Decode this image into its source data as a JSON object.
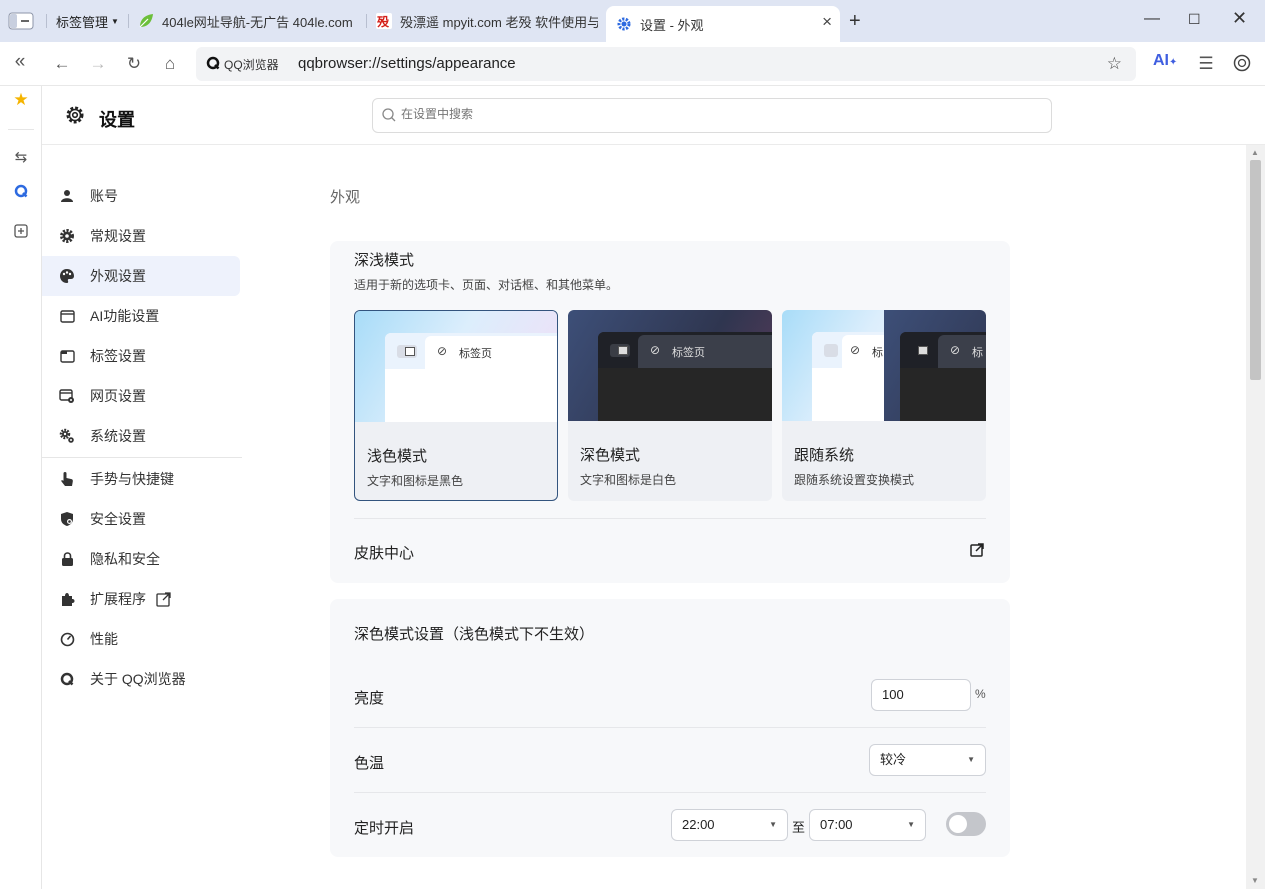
{
  "tabs": {
    "group_label": "标签管理",
    "items": [
      {
        "title": "404le网址导航-无广告 404le.com"
      },
      {
        "title": "殁漂遥 mpyit.com 老殁 软件使用与"
      },
      {
        "title": "设置 - 外观"
      }
    ]
  },
  "address_bar": {
    "brand": "QQ浏览器",
    "url": "qqbrowser://settings/appearance",
    "ai_label": "AI"
  },
  "header": {
    "title": "设置",
    "search_placeholder": "在设置中搜索"
  },
  "nav": {
    "items": [
      {
        "label": "账号",
        "icon": "user-icon"
      },
      {
        "label": "常规设置",
        "icon": "gear-icon"
      },
      {
        "label": "外观设置",
        "icon": "palette-icon"
      },
      {
        "label": "AI功能设置",
        "icon": "window-icon"
      },
      {
        "label": "标签设置",
        "icon": "tab-icon"
      },
      {
        "label": "网页设置",
        "icon": "webpage-settings-icon"
      },
      {
        "label": "系统设置",
        "icon": "system-gears-icon"
      },
      {
        "label": "手势与快捷键",
        "icon": "hand-pointer-icon"
      },
      {
        "label": "安全设置",
        "icon": "shield-icon"
      },
      {
        "label": "隐私和安全",
        "icon": "lock-icon"
      },
      {
        "label": "扩展程序",
        "icon": "puzzle-icon"
      },
      {
        "label": "性能",
        "icon": "gauge-icon"
      },
      {
        "label": "关于 QQ浏览器",
        "icon": "qq-browser-icon"
      }
    ],
    "active_index": 2
  },
  "page": {
    "heading": "外观",
    "theme_card": {
      "title": "深浅模式",
      "subtitle": "适用于新的选项卡、页面、对话框、和其他菜单。",
      "preview_tab_label": "标签页",
      "preview_tab_label_short": "标",
      "modes": [
        {
          "name": "浅色模式",
          "desc": "文字和图标是黑色"
        },
        {
          "name": "深色模式",
          "desc": "文字和图标是白色"
        },
        {
          "name": "跟随系统",
          "desc": "跟随系统设置变换模式"
        }
      ],
      "selected_mode": "浅色模式",
      "skin_center": "皮肤中心"
    },
    "dark_card": {
      "title": "深色模式设置（浅色模式下不生效）",
      "brightness_label": "亮度",
      "brightness_value": "100",
      "brightness_unit": "%",
      "color_temp_label": "色温",
      "color_temp_value": "较冷",
      "schedule_label": "定时开启",
      "start_time": "22:00",
      "to_label": "至",
      "end_time": "07:00",
      "schedule_enabled": false
    }
  },
  "colors": {
    "accent": "#3f5ee0",
    "active_nav_bg": "#eef2fc",
    "tabstrip_bg": "#dfe5f3",
    "selected_border": "#33547e"
  }
}
